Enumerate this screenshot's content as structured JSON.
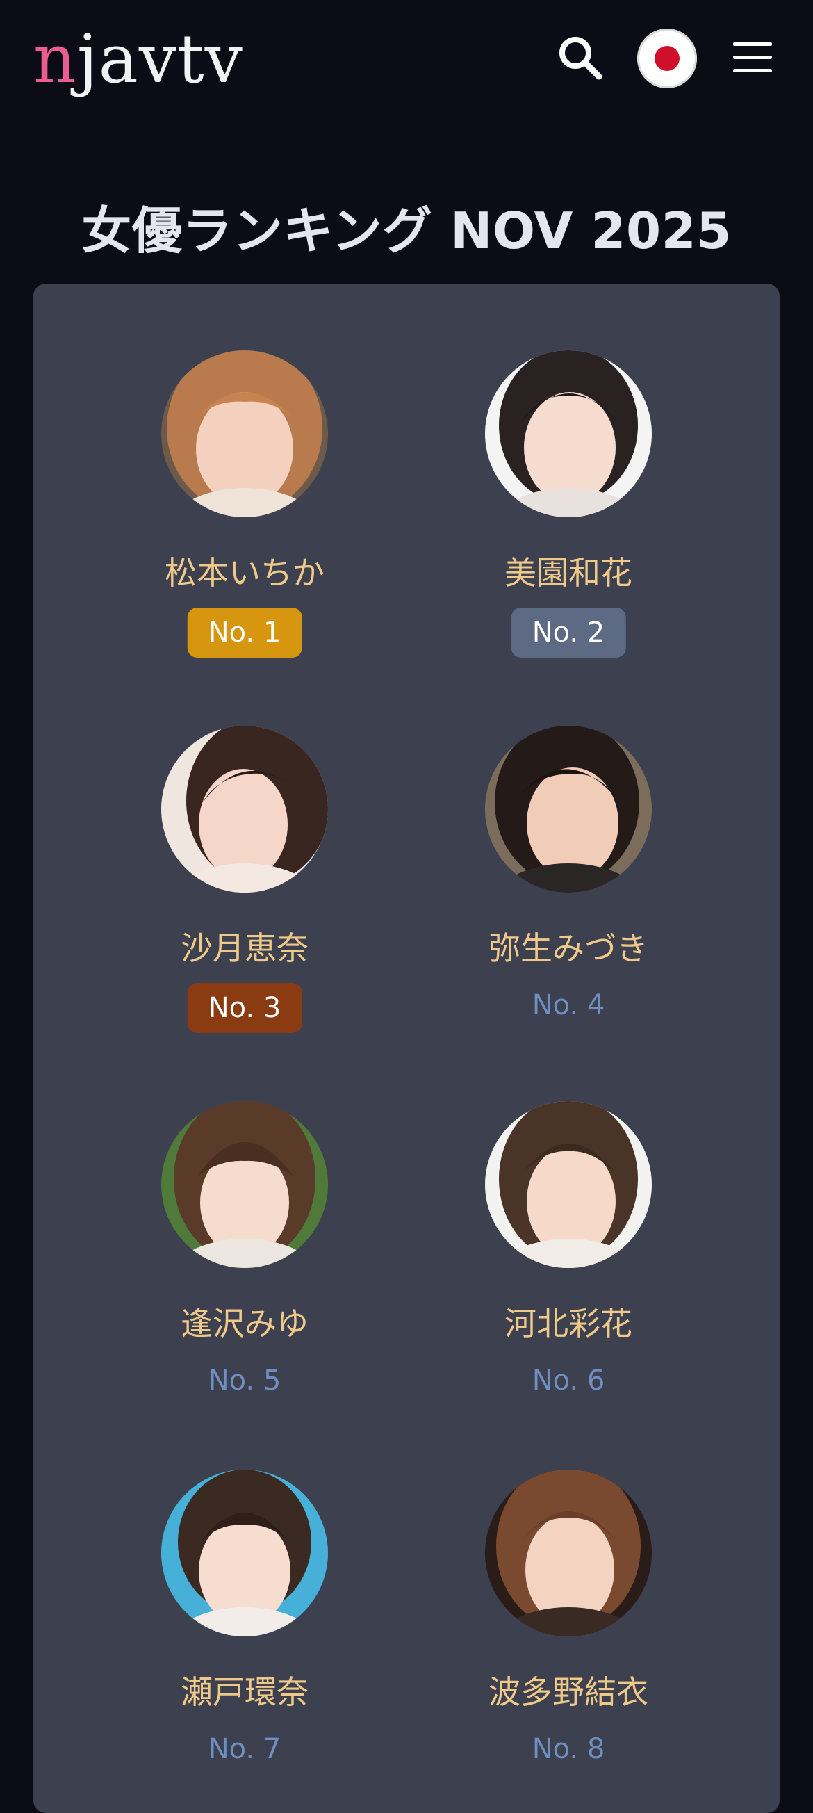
{
  "header": {
    "logo_first": "n",
    "logo_rest": "javtv"
  },
  "title": "女優ランキング NOV 2025",
  "colors": {
    "background": "#0b0c16",
    "panel": "#3c404f",
    "name": "#efc98a",
    "rank_text": "#6e8fc0",
    "gold": "#d79610",
    "silver": "#5d6a84",
    "bronze": "#8a3b12",
    "logo_accent": "#ec5d8f"
  },
  "icons": {
    "search": "search-icon",
    "language": "japan-flag-icon",
    "menu": "hamburger-menu-icon"
  },
  "actresses": [
    {
      "name": "松本いちか",
      "rank": "No. 1"
    },
    {
      "name": "美園和花",
      "rank": "No. 2"
    },
    {
      "name": "沙月恵奈",
      "rank": "No. 3"
    },
    {
      "name": "弥生みづき",
      "rank": "No. 4"
    },
    {
      "name": "逢沢みゆ",
      "rank": "No. 5"
    },
    {
      "name": "河北彩花",
      "rank": "No. 6"
    },
    {
      "name": "瀬戸環奈",
      "rank": "No. 7"
    },
    {
      "name": "波多野結衣",
      "rank": "No. 8"
    }
  ]
}
